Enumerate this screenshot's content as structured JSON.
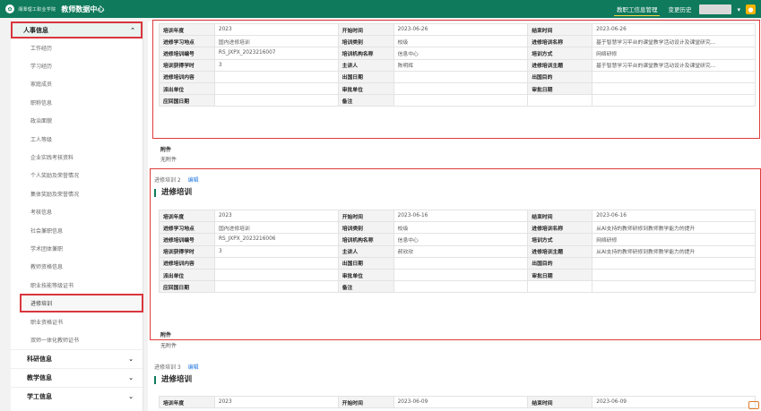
{
  "header": {
    "school_name": "湘潭理工职业学院",
    "system_title": "教师数据中心",
    "nav_active": "教职工信息管理",
    "nav_other": "变更历史"
  },
  "sidebar": {
    "section_personnel": "人事信息",
    "items": [
      "工作经历",
      "学习经历",
      "家庭成员",
      "职称信息",
      "政治面貌",
      "工人等级",
      "企业实践考核资料",
      "个人奖励及荣誉情况",
      "集体奖励及荣誉情况",
      "考核信息",
      "社会兼职信息",
      "学术团体兼职",
      "教师资格信息",
      "职业技能等级证书",
      "进修培训",
      "职业资格证书",
      "双师一体化教师证书"
    ],
    "active_item": "进修培训",
    "groups": [
      "科研信息",
      "教学信息",
      "学工信息"
    ]
  },
  "records": [
    {
      "heading_line": "",
      "section_title": "",
      "table": [
        [
          "培训年度",
          "2023",
          "开始时间",
          "2023-06-26",
          "结束时间",
          "2023-06-26"
        ],
        [
          "进修学习地点",
          "国内进修培训",
          "培训类别",
          "校级",
          "进修培训名称",
          "基于智慧学习平台的课堂教学活动设计及课堂研究..."
        ],
        [
          "进修培训编号",
          "RS_JXPX_2023216007",
          "培训机构名称",
          "信息中心",
          "培训方式",
          "网络研修"
        ],
        [
          "培训获得学时",
          "3",
          "主讲人",
          "陈明辉",
          "进修培训主题",
          "基于智慧学习平台的课堂教学活动设计及课堂研究..."
        ],
        [
          "进修培训内容",
          "",
          "出国日期",
          "",
          "出国目的",
          ""
        ],
        [
          "派出单位",
          "",
          "审批单位",
          "",
          "审批日期",
          ""
        ],
        [
          "应回国日期",
          "",
          "备注",
          "",
          "",
          ""
        ]
      ],
      "attach_title": "附件",
      "attach_value": "无附件"
    },
    {
      "heading_line": "进修培训 2",
      "edit_label": "编辑",
      "section_title": "进修培训",
      "table": [
        [
          "培训年度",
          "2023",
          "开始时间",
          "2023-06-16",
          "结束时间",
          "2023-06-16"
        ],
        [
          "进修学习地点",
          "国内进修培训",
          "培训类别",
          "校级",
          "进修培训名称",
          "从AI支持的教师研修到教师教学能力的提升"
        ],
        [
          "进修培训编号",
          "RS_JXPX_2023216006",
          "培训机构名称",
          "信息中心",
          "培训方式",
          "网络研修"
        ],
        [
          "培训获得学时",
          "3",
          "主讲人",
          "郝欣欣",
          "进修培训主题",
          "从AI支持的教师研修到教师教学能力的提升"
        ],
        [
          "进修培训内容",
          "",
          "出国日期",
          "",
          "出国目的",
          ""
        ],
        [
          "派出单位",
          "",
          "审批单位",
          "",
          "审批日期",
          ""
        ],
        [
          "应回国日期",
          "",
          "备注",
          "",
          "",
          ""
        ]
      ],
      "attach_title": "附件",
      "attach_value": "无附件"
    },
    {
      "heading_line": "进修培训 3",
      "edit_label": "编辑",
      "section_title": "进修培训",
      "table": [
        [
          "培训年度",
          "2023",
          "开始时间",
          "2023-06-09",
          "结束时间",
          "2023-06-09"
        ]
      ]
    }
  ]
}
